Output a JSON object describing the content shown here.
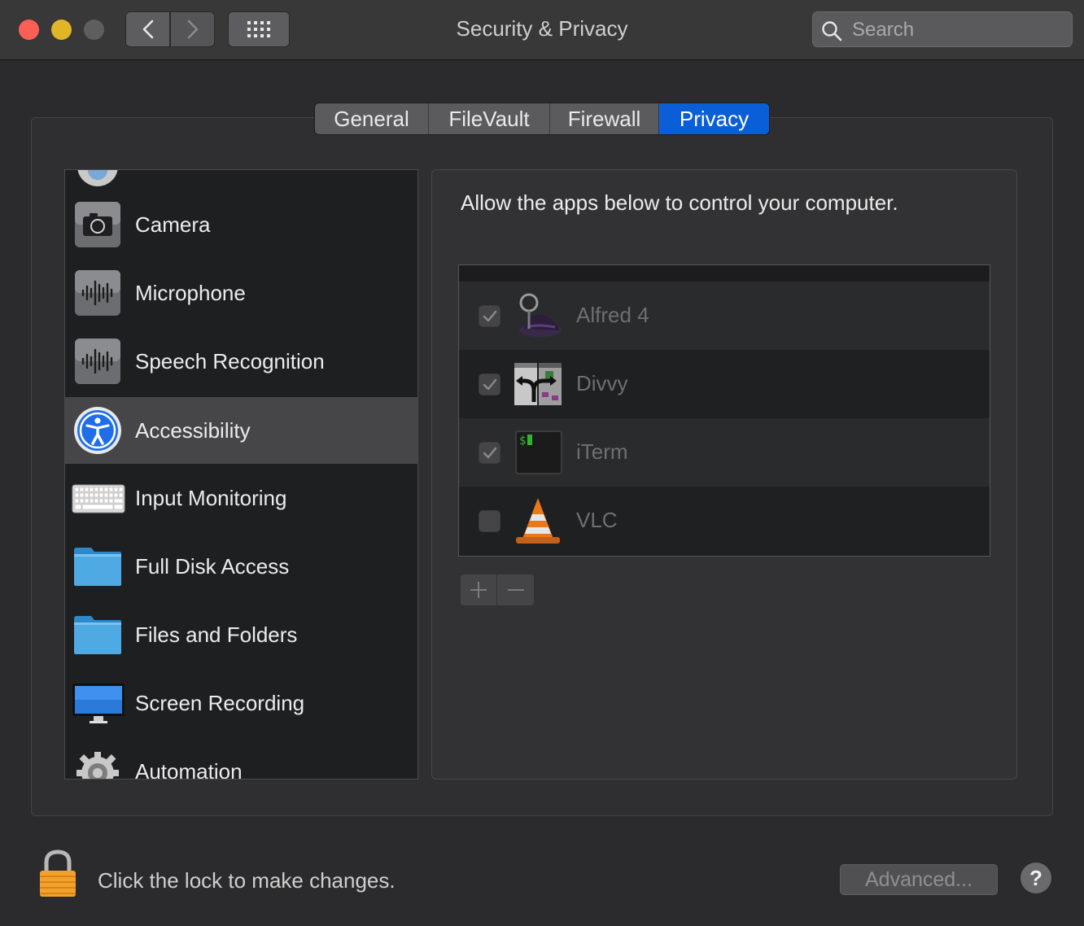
{
  "window": {
    "title": "Security & Privacy",
    "search_placeholder": "Search"
  },
  "tabs": [
    {
      "label": "General",
      "active": false
    },
    {
      "label": "FileVault",
      "active": false
    },
    {
      "label": "Firewall",
      "active": false
    },
    {
      "label": "Privacy",
      "active": true
    }
  ],
  "sidebar": {
    "items": [
      {
        "label": "Camera",
        "icon": "camera-icon"
      },
      {
        "label": "Microphone",
        "icon": "microphone-icon"
      },
      {
        "label": "Speech Recognition",
        "icon": "speech-recognition-icon"
      },
      {
        "label": "Accessibility",
        "icon": "accessibility-icon",
        "selected": true
      },
      {
        "label": "Input Monitoring",
        "icon": "keyboard-icon"
      },
      {
        "label": "Full Disk Access",
        "icon": "folder-icon"
      },
      {
        "label": "Files and Folders",
        "icon": "folder-icon"
      },
      {
        "label": "Screen Recording",
        "icon": "display-icon"
      },
      {
        "label": "Automation",
        "icon": "gear-icon"
      }
    ]
  },
  "main": {
    "description": "Allow the apps below to control your computer.",
    "apps": [
      {
        "name": "Alfred 4",
        "checked": true,
        "icon": "alfred-icon"
      },
      {
        "name": "Divvy",
        "checked": true,
        "icon": "divvy-icon"
      },
      {
        "name": "iTerm",
        "checked": true,
        "icon": "iterm-icon"
      },
      {
        "name": "VLC",
        "checked": false,
        "icon": "vlc-icon"
      }
    ],
    "add_symbol": "+",
    "remove_symbol": "−"
  },
  "footer": {
    "lock_text": "Click the lock to make changes.",
    "advanced_label": "Advanced...",
    "help_label": "?"
  },
  "colors": {
    "accent": "#0a5fd8",
    "close": "#fd5f57",
    "minimize": "#e0b528"
  }
}
